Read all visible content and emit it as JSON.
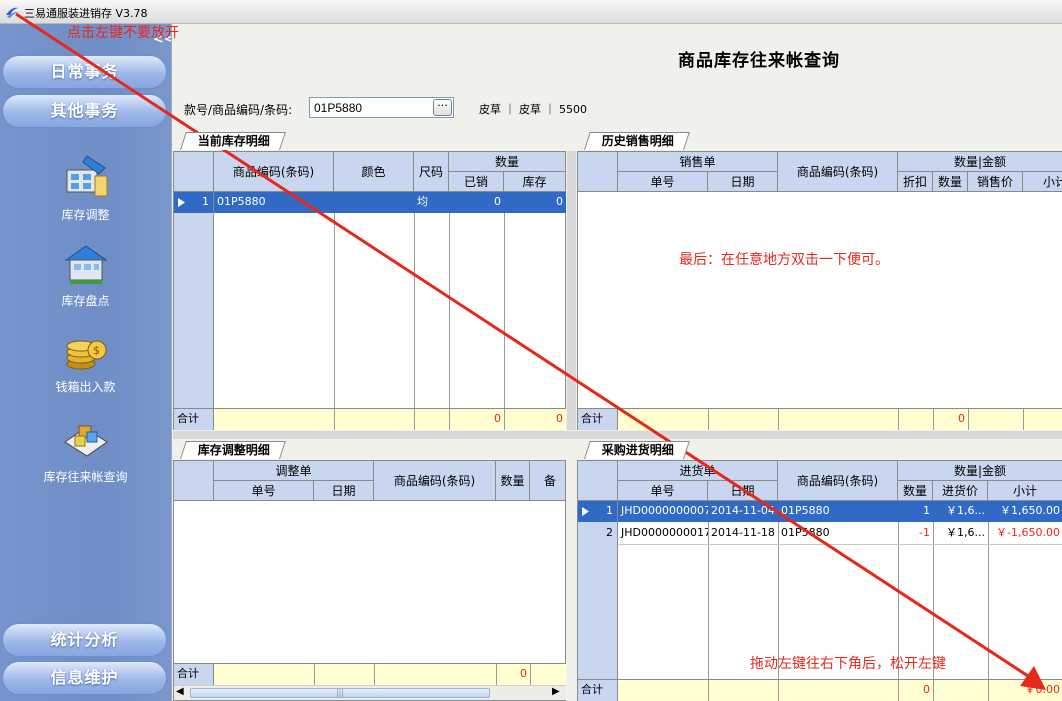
{
  "window": {
    "title": "三易通服装进销存 V3.78"
  },
  "sidebar": {
    "collapse_label": "<<",
    "top_sections": [
      "日常事务",
      "其他事务"
    ],
    "items": [
      {
        "label": "库存调整",
        "icon": "inventory-adjust-icon"
      },
      {
        "label": "库存盘点",
        "icon": "inventory-count-icon"
      },
      {
        "label": "钱箱出入款",
        "icon": "cashbox-icon"
      },
      {
        "label": "库存往来帐查询",
        "icon": "inventory-ledger-icon"
      }
    ],
    "bottom_sections": [
      "统计分析",
      "信息维护"
    ]
  },
  "annotations": {
    "hint1": "点击左键不要放开",
    "hint2": "最后：在任意地方双击一下便可。",
    "hint3": "拖动左键往右下角后，松开左键"
  },
  "page": {
    "title": "商品库存往来帐查询"
  },
  "search": {
    "label": "款号/商品编码/条码:",
    "value": "01P5880",
    "button": "···",
    "info": "皮草 ｜ 皮草 ｜ 5500"
  },
  "stock_panel": {
    "tab": "当前库存明细",
    "headers": {
      "code": "商品编码(条码)",
      "color": "颜色",
      "size": "尺码",
      "qty_group": "数量",
      "sold": "已销",
      "stock": "库存"
    },
    "rows": [
      {
        "index": "1",
        "code": "01P5880",
        "color": "",
        "size": "均",
        "sold": "0",
        "stock": "0"
      }
    ],
    "footer": {
      "label": "合计",
      "sold": "0",
      "stock": "0"
    }
  },
  "sales_panel": {
    "tab": "历史销售明细",
    "headers": {
      "order_group": "销售单",
      "order_no": "单号",
      "date": "日期",
      "code": "商品编码(条码)",
      "qty_amount_group": "数量|金额",
      "discount": "折扣",
      "qty": "数量",
      "price": "销售价",
      "subtotal": "小计"
    },
    "rows": [],
    "footer": {
      "label": "合计",
      "qty": "0"
    }
  },
  "adjust_panel": {
    "tab": "库存调整明细",
    "headers": {
      "order_group": "调整单",
      "order_no": "单号",
      "date": "日期",
      "code": "商品编码(条码)",
      "qty": "数量",
      "remark": "备"
    },
    "rows": [],
    "footer": {
      "label": "合计",
      "qty": "0"
    },
    "scroll_grip": "|||"
  },
  "purchase_panel": {
    "tab": "采购进货明细",
    "headers": {
      "order_group": "进货单",
      "order_no": "单号",
      "date": "日期",
      "code": "商品编码(条码)",
      "qty_amount_group": "数量|金额",
      "qty": "数量",
      "price": "进货价",
      "subtotal": "小计"
    },
    "rows": [
      {
        "index": "1",
        "order_no": "JHD0000000007",
        "date": "2014-11-04",
        "code": "01P5880",
        "qty": "1",
        "price": "￥1,6...",
        "subtotal": "￥1,650.00"
      },
      {
        "index": "2",
        "order_no": "JHD0000000017",
        "date": "2014-11-18",
        "code": "01P5880",
        "qty": "-1",
        "price": "￥1,6...",
        "subtotal": "￥-1,650.00"
      }
    ],
    "footer": {
      "label": "合计",
      "qty": "0",
      "subtotal": "￥0.00"
    }
  },
  "colors": {
    "accent": "#316ac5",
    "annotation": "#e8271b",
    "sidebar": "#7795cc",
    "footer": "#ffffd2"
  }
}
